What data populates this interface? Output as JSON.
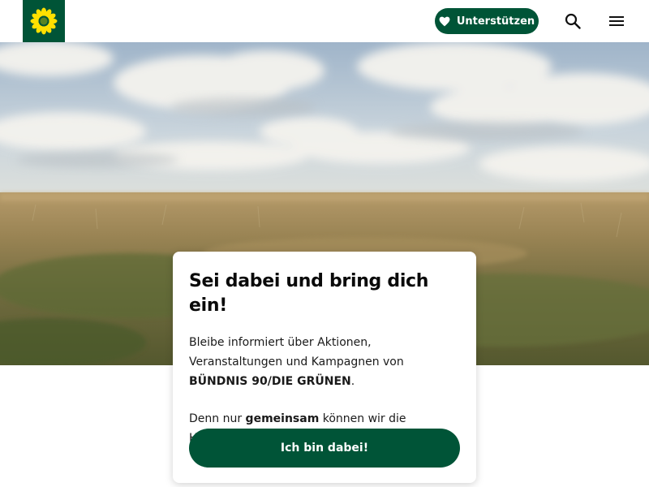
{
  "header": {
    "logo_icon": "sunflower-icon",
    "support_label": "Unterstützen",
    "support_icon": "heart-icon",
    "search_icon": "search-icon",
    "menu_icon": "menu-icon"
  },
  "hero": {
    "image": "field-under-cloudy-sky"
  },
  "card": {
    "title": "Sei dabei und bring dich ein!",
    "para1": {
      "pre": "Bleibe informiert über Aktionen, Veranstaltungen und Kampagnen von ",
      "strong": "BÜNDNIS 90/DIE GRÜNEN",
      "post": "."
    },
    "para2": {
      "pre": "Denn nur ",
      "strong": "gemeinsam",
      "post": " können wir die Herausforderungen unserer Zeit stemmen!"
    },
    "cta_label": "Ich bin dabei!"
  },
  "colors": {
    "brand_green": "#005437",
    "sunflower_yellow": "#FFE000"
  }
}
